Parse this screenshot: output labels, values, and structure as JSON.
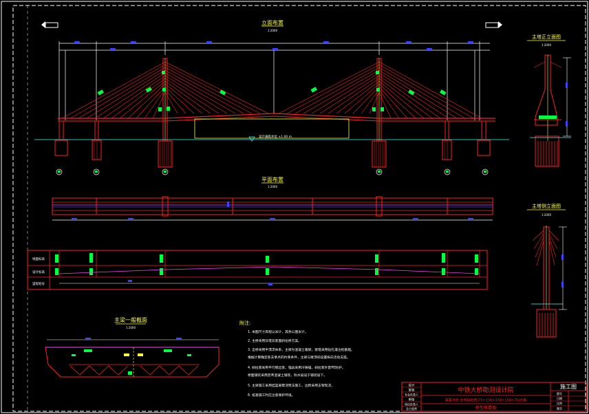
{
  "colors": {
    "background": "#000000",
    "red": "#ff2020",
    "blue": "#4040ff",
    "green": "#00ff40",
    "yellow": "#ffff40",
    "white": "#ffffff",
    "cyan": "#40ffff",
    "magenta": "#ff40ff",
    "frame": "#ffffff"
  },
  "drawing": {
    "elevation_title": "立面布置",
    "plan_title": "平面布置",
    "section_title": "主梁一般截面",
    "tower_front_title": "主塔正立面图",
    "tower_side_title": "主塔侧立面图",
    "notes_title": "附注:",
    "water_level_label": "设计通航水位 ±1.00 m",
    "scale": "1:2000",
    "notes": [
      "1. 本图尺寸高程以米计，其余以厘米计。",
      "2. 主桥采用双塔双索面斜拉桥方案。",
      "3. 全桥采用半漂浮体系，主梁为混凝土箱梁，索塔采用钻孔灌注桩基础。",
      "   根据计算确定各支承点的约束条件，主梁与墩顶间设置纵向活动支座。",
      "4. 斜拉索采用平行钢丝索，锚具采用冷铸锚，斜拉索外套PE防护。",
      "   桥面铺装采用沥青混凝土铺装，防水层设于铺装层下。",
      "5. 主梁施工采用挂篮悬臂浇筑法施工，边跨采用支架现浇。",
      "6. 桩基施工时应注意保护环境。"
    ]
  },
  "title_block": {
    "institute": "中铁大桥勘测设计院",
    "stage": "施工图",
    "project": "某某大桥 主桥斜拉桥(75+150+350+150+75)方案",
    "drawing_name": "桥型布置图",
    "left_labels": [
      "设计",
      "复核",
      "专业负责人",
      "审核",
      "项目负责人",
      "总工程师"
    ],
    "right_labels": [
      "图号",
      "日期",
      "比例",
      "版次"
    ]
  },
  "table": {
    "row_labels": [
      "地面标高",
      "设计标高",
      "里程桩号"
    ]
  }
}
